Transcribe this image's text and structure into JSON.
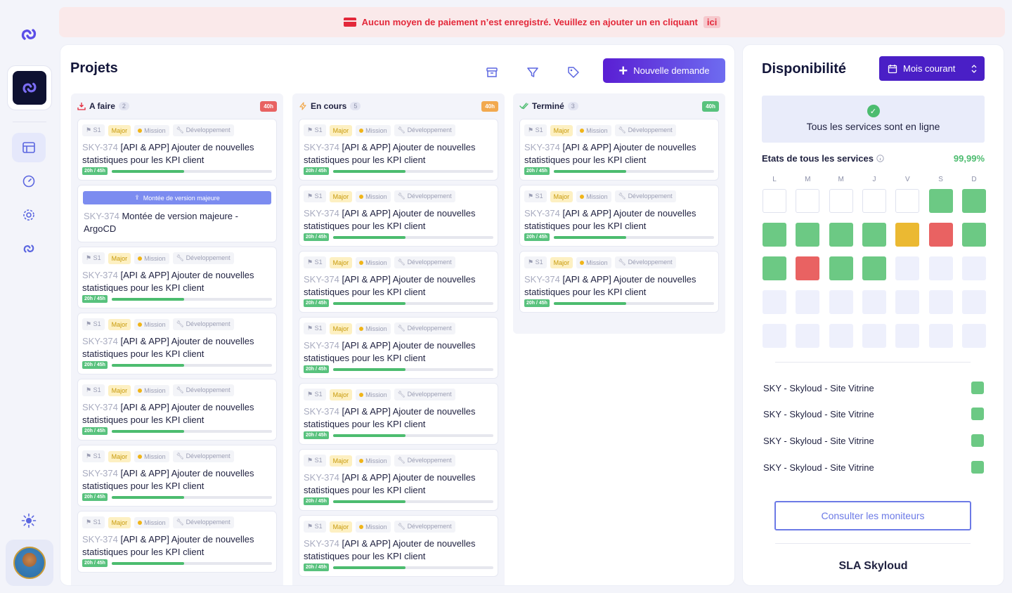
{
  "banner": {
    "message": "Aucun moyen de paiement n’est enregistré. Veuillez en ajouter un en cliquant",
    "link": "ici"
  },
  "projects": {
    "title": "Projets",
    "new_request_label": "Nouvelle demande",
    "columns": [
      {
        "title": "A faire",
        "count": "2",
        "hours": "40h",
        "hours_color": "#e86262"
      },
      {
        "title": "En cours",
        "count": "5",
        "hours": "40h",
        "hours_color": "#f2a94e"
      },
      {
        "title": "Terminé",
        "count": "3",
        "hours": "40h",
        "hours_color": "#58c27d"
      }
    ],
    "task": {
      "sprint": "S1",
      "priority": "Major",
      "type": "Mission",
      "category": "Développement",
      "key": "SKY-374",
      "title_line1": "[API & APP] Ajouter de nouvelles",
      "title_line2": "statistiques pour les KPI client",
      "progress_label": "20h / 45h",
      "progress": 0.45
    },
    "special_task": {
      "button_label": "Montée de version majeure",
      "key": "SKY-374",
      "title_line1": "Montée de version majeure -",
      "title_line2": "ArgoCD"
    }
  },
  "availability": {
    "title": "Disponibilité",
    "period_label": "Mois courant",
    "status_text": "Tous les services sont en ligne",
    "states_label": "Etats de tous les services",
    "uptime": "99,99%",
    "days": [
      "L",
      "M",
      "M",
      "J",
      "V",
      "S",
      "D"
    ],
    "calendar": [
      [
        "empty",
        "empty",
        "empty",
        "empty",
        "empty",
        "green",
        "green"
      ],
      [
        "green",
        "green",
        "green",
        "green",
        "yellow",
        "red",
        "green"
      ],
      [
        "green",
        "red",
        "green",
        "green",
        "future",
        "future",
        "future"
      ],
      [
        "future",
        "future",
        "future",
        "future",
        "future",
        "future",
        "future"
      ],
      [
        "future",
        "future",
        "future",
        "future",
        "future",
        "future",
        "future"
      ]
    ],
    "services": [
      {
        "name": "SKY - Skyloud - Site Vitrine"
      },
      {
        "name": "SKY - Skyloud - Site Vitrine"
      },
      {
        "name": "SKY - Skyloud - Site Vitrine"
      },
      {
        "name": "SKY - Skyloud - Site Vitrine"
      }
    ],
    "consult_label": "Consulter les moniteurs",
    "sla_title": "SLA Skyloud"
  },
  "colors": {
    "accent": "#5a1ed3",
    "success": "#4cbc6f",
    "danger": "#e3283a"
  }
}
